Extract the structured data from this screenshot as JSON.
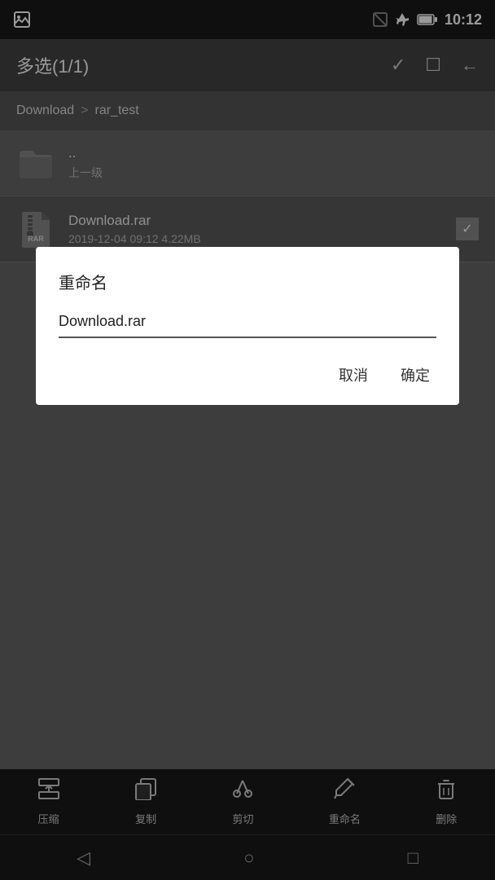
{
  "statusBar": {
    "time": "10:12"
  },
  "toolbar": {
    "title": "多选(1/1)",
    "checkIcon": "✓",
    "squareIcon": "☐",
    "backIcon": "←"
  },
  "breadcrumb": {
    "parent": "Download",
    "separator": ">",
    "current": "rar_test"
  },
  "fileList": [
    {
      "type": "folder",
      "name": "..",
      "sublabel": "上一级",
      "meta": "",
      "selected": false
    },
    {
      "type": "rar",
      "name": "Download.rar",
      "sublabel": "",
      "meta": "2019-12-04 09:12  4.22MB",
      "selected": true
    }
  ],
  "dialog": {
    "title": "重命名",
    "inputValue": "Download.rar",
    "cancelLabel": "取消",
    "confirmLabel": "确定"
  },
  "bottomToolbar": {
    "actions": [
      {
        "label": "压缩",
        "icon": "compress"
      },
      {
        "label": "复制",
        "icon": "copy"
      },
      {
        "label": "剪切",
        "icon": "scissors"
      },
      {
        "label": "重命名",
        "icon": "pencil"
      },
      {
        "label": "删除",
        "icon": "trash"
      }
    ]
  },
  "navBar": {
    "backIcon": "◁",
    "homeIcon": "○",
    "squareIcon": "□"
  }
}
